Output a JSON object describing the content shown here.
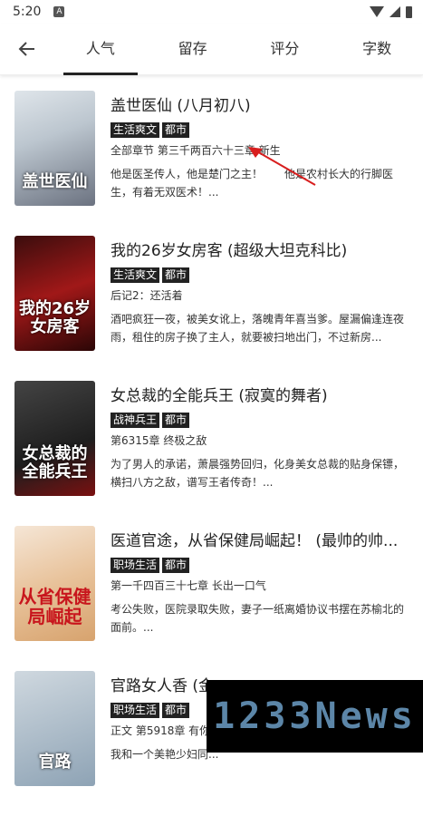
{
  "status_bar": {
    "time": "5:20",
    "sim_label": "A"
  },
  "toolbar": {
    "back_icon": "back-arrow-icon"
  },
  "tabs": [
    {
      "label": "人气",
      "active": true
    },
    {
      "label": "留存",
      "active": false
    },
    {
      "label": "评分",
      "active": false
    },
    {
      "label": "字数",
      "active": false
    }
  ],
  "books": [
    {
      "title": "盖世医仙 (八月初八)",
      "tags": [
        "生活爽文",
        "都市"
      ],
      "latest": "全部章节 第三千两百六十三章 新生",
      "desc": "他是医圣传人，他是楚门之主！　　他是农村长大的行脚医生，有着无双医术！...",
      "cover_text": "盖世医仙"
    },
    {
      "title": "我的26岁女房客 (超级大坦克科比)",
      "tags": [
        "生活爽文",
        "都市"
      ],
      "latest": "后记2：还活着",
      "desc": "酒吧疯狂一夜，被美女讹上，落魄青年喜当爹。屋漏偏逢连夜雨，租住的房子换了主人，就要被扫地出门，不过新房...",
      "cover_text": "我的26岁女房客"
    },
    {
      "title": "女总裁的全能兵王 (寂寞的舞者)",
      "tags": [
        "战神兵王",
        "都市"
      ],
      "latest": "第6315章 终极之敌",
      "desc": "为了男人的承诺，萧晨强势回归，化身美女总裁的贴身保镖，横扫八方之敌，谱写王者传奇！...",
      "cover_text": "女总裁的全能兵王"
    },
    {
      "title": "医道官途，从省保健局崛起！ (最帅的帅...",
      "tags": [
        "职场生活",
        "都市"
      ],
      "latest": "第一千四百三十七章 长出一口气",
      "desc": "考公失败，医院录取失败，妻子一纸离婚协议书摆在苏榆北的面前。...",
      "cover_text": "从省保健局崛起"
    },
    {
      "title": "官路女人香 (金",
      "tags": [
        "职场生活",
        "都市"
      ],
      "latest": "正文 第5918章 有你",
      "desc": "我和一个美艳少妇同...",
      "cover_text": "官路"
    }
  ],
  "watermark": "1233News"
}
